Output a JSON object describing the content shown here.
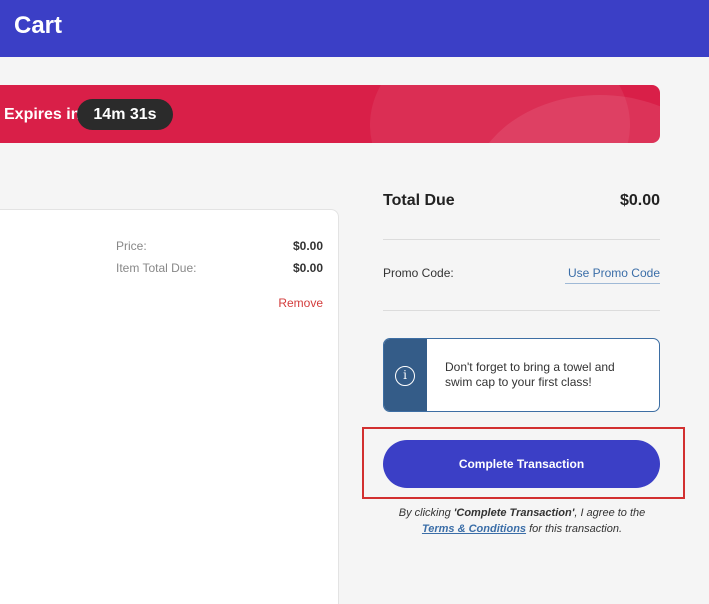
{
  "header": {
    "title": "Cart"
  },
  "timer": {
    "label": "Expires in",
    "value": "14m 31s"
  },
  "item": {
    "price_label": "Price:",
    "price_value": "$0.00",
    "item_total_label": "Item Total Due:",
    "item_total_value": "$0.00",
    "remove_label": "Remove"
  },
  "summary": {
    "total_label": "Total Due",
    "total_value": "$0.00",
    "promo_label": "Promo Code:",
    "promo_link": "Use Promo Code"
  },
  "info": {
    "icon": "info-icon",
    "message": "Don't forget to bring a towel and swim cap to your first class!"
  },
  "checkout": {
    "button_label": "Complete Transaction",
    "terms_prefix": "By clicking ",
    "terms_emphasis": "'Complete Transaction'",
    "terms_middle": ", I agree to the",
    "terms_link": "Terms & Conditions",
    "terms_suffix": " for this transaction."
  },
  "colors": {
    "header": "#3b3fc6",
    "banner": "#d91f48",
    "button": "#3b3fc6",
    "info_accent": "#345c88",
    "remove": "#d33c3c",
    "link": "#3b6ea8"
  }
}
